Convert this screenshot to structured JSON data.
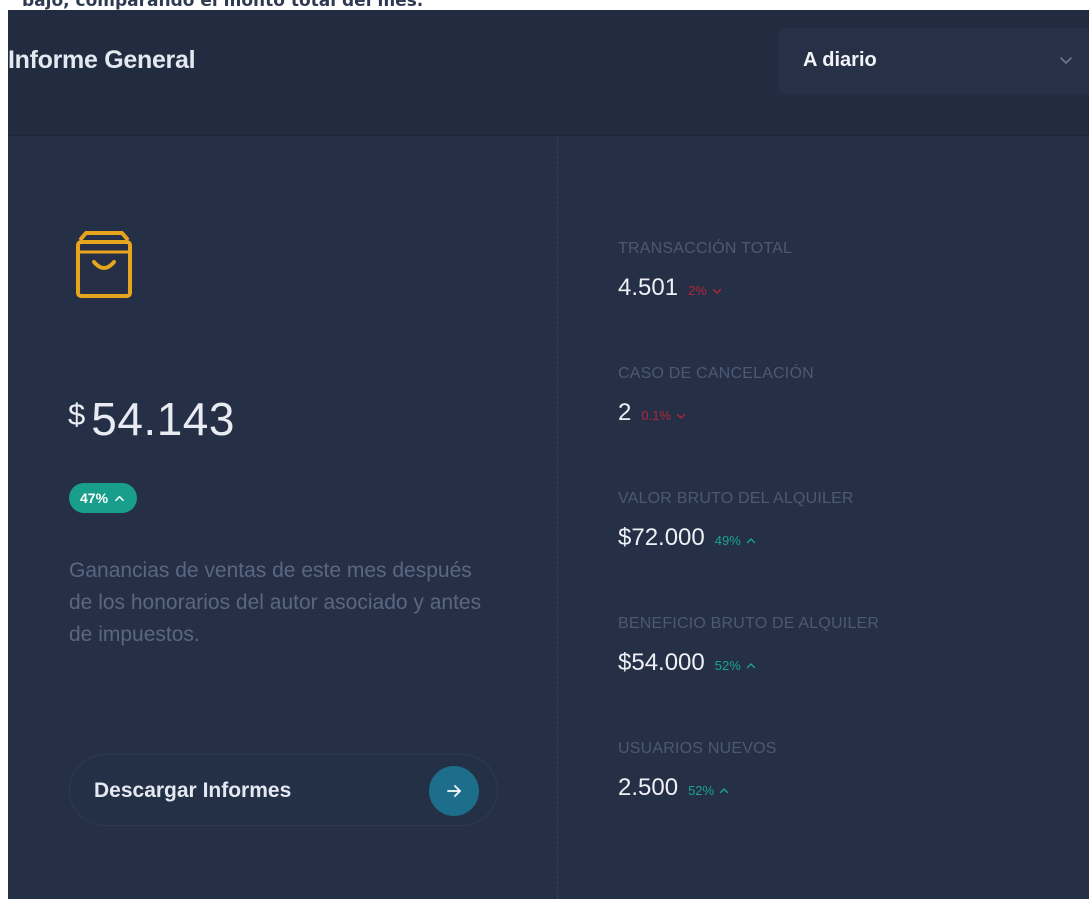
{
  "caption": "bajo, comparando el monto total del mes.",
  "header": {
    "title": "Informe General",
    "period_select": {
      "selected": "A diario",
      "icon": "chevron-down-icon"
    }
  },
  "summary": {
    "icon": "shopping-bag-icon",
    "currency": "$",
    "amount": "54.143",
    "trend": {
      "percent": "47%",
      "direction": "up",
      "color": "#1a9e8c"
    },
    "description": "Ganancias de ventas de este mes después de los honorarios del autor asociado y antes de impuestos.",
    "download_button": {
      "label": "Descargar Informes",
      "icon": "arrow-right-icon"
    }
  },
  "stats": [
    {
      "label": "TRANSACCIÓN TOTAL",
      "value": "4.501",
      "delta": "2%",
      "direction": "down"
    },
    {
      "label": "CASO DE CANCELACIÓN",
      "value": "2",
      "delta": "0.1%",
      "direction": "down"
    },
    {
      "label": "VALOR BRUTO DEL ALQUILER",
      "value": "$72.000",
      "delta": "49%",
      "direction": "up"
    },
    {
      "label": "BENEFICIO BRUTO DE ALQUILER",
      "value": "$54.000",
      "delta": "52%",
      "direction": "up"
    },
    {
      "label": "USUARIOS NUEVOS",
      "value": "2.500",
      "delta": "52%",
      "direction": "up"
    }
  ],
  "colors": {
    "background": "#253046",
    "accent_up": "#1aa38f",
    "accent_down": "#b3263a",
    "icon_gold": "#e6a51c"
  }
}
